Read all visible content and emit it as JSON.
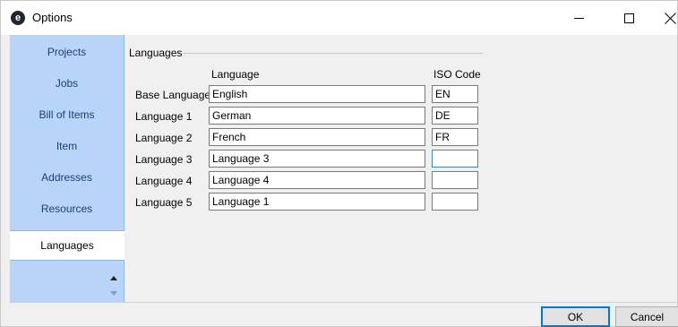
{
  "window": {
    "title": "Options",
    "app_icon_letter": "e"
  },
  "sidebar": {
    "items": [
      {
        "label": "Projects",
        "active": false
      },
      {
        "label": "Jobs",
        "active": false
      },
      {
        "label": "Bill of Items",
        "active": false
      },
      {
        "label": "Item",
        "active": false
      },
      {
        "label": "Addresses",
        "active": false
      },
      {
        "label": "Resources",
        "active": false
      },
      {
        "label": "Languages",
        "active": true
      }
    ]
  },
  "languages": {
    "group_title": "Languages",
    "col_language": "Language",
    "col_iso": "ISO Code",
    "rows": [
      {
        "label": "Base Language",
        "name": "English",
        "iso": "EN"
      },
      {
        "label": "Language 1",
        "name": "German",
        "iso": "DE"
      },
      {
        "label": "Language 2",
        "name": "French",
        "iso": "FR"
      },
      {
        "label": "Language 3",
        "name": "Language 3",
        "iso": ""
      },
      {
        "label": "Language 4",
        "name": "Language 4",
        "iso": ""
      },
      {
        "label": "Language 5",
        "name": "Language 1",
        "iso": ""
      }
    ]
  },
  "buttons": {
    "ok": "OK",
    "cancel": "Cancel"
  }
}
